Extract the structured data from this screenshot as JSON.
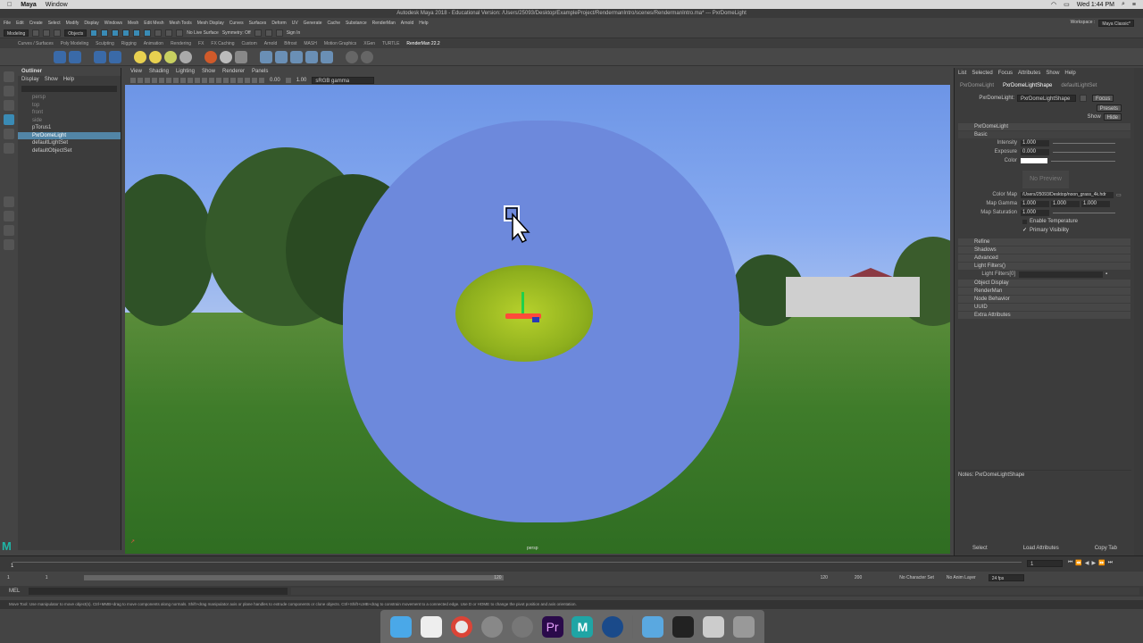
{
  "mac_menu": {
    "app": "Maya",
    "window": "Window",
    "clock": "Wed 1:44 PM"
  },
  "window_title": "Autodesk Maya 2018 - Educational Version: /Users/25093/Desktop/ExampleProject/RendermanIntro/scenes/RendermanIntro.ma*  ---  PxrDomeLight",
  "main_menu": [
    "File",
    "Edit",
    "Create",
    "Select",
    "Modify",
    "Display",
    "Windows",
    "Mesh",
    "Edit Mesh",
    "Mesh Tools",
    "Mesh Display",
    "Curves",
    "Surfaces",
    "Deform",
    "UV",
    "Generate",
    "Cache",
    "Substance",
    "RenderMan",
    "Arnold",
    "Help"
  ],
  "workspace": {
    "label": "Workspace :",
    "value": "Maya Classic*"
  },
  "status": {
    "mode": "Modeling",
    "objects": "Objects",
    "live_surface": "No Live Surface",
    "symmetry": "Symmetry: Off",
    "sign_in": "Sign In"
  },
  "shelf_tabs": [
    "Curves / Surfaces",
    "Poly Modeling",
    "Sculpting",
    "Rigging",
    "Animation",
    "Rendering",
    "FX",
    "FX Caching",
    "Custom",
    "Arnold",
    "Bifrost",
    "MASH",
    "Motion Graphics",
    "XGen",
    "TURTLE",
    "RenderMan 22.2"
  ],
  "shelf_active": "RenderMan 22.2",
  "outliner": {
    "title": "Outliner",
    "menu": [
      "Display",
      "Show",
      "Help"
    ],
    "items": [
      {
        "label": "persp",
        "state": "dim"
      },
      {
        "label": "top",
        "state": "dim"
      },
      {
        "label": "front",
        "state": "dim"
      },
      {
        "label": "side",
        "state": "dim"
      },
      {
        "label": "pTorus1",
        "state": "normal"
      },
      {
        "label": "PxrDomeLight",
        "state": "sel"
      },
      {
        "label": "defaultLightSet",
        "state": "normal"
      },
      {
        "label": "defaultObjectSet",
        "state": "normal"
      }
    ]
  },
  "viewport": {
    "menu": [
      "View",
      "Shading",
      "Lighting",
      "Show",
      "Renderer",
      "Panels"
    ],
    "exposure": "0.00",
    "gamma": "1.00",
    "color_space": "sRGB gamma",
    "camera_label": "persp"
  },
  "attribute_editor": {
    "menu": [
      "List",
      "Selected",
      "Focus",
      "Attributes",
      "Show",
      "Help"
    ],
    "tabs": [
      "PxrDomeLight",
      "PxrDomeLightShape",
      "defaultLightSet"
    ],
    "active_tab": "PxrDomeLightShape",
    "node_label": "PxrDomeLight:",
    "node_value": "PxrDomeLightShape",
    "buttons": {
      "focus": "Focus",
      "presets": "Presets",
      "show": "Show",
      "hide": "Hide"
    },
    "section_main": "PxrDomeLight",
    "section_basic": "Basic",
    "intensity": {
      "label": "Intensity",
      "value": "1.000"
    },
    "exposure": {
      "label": "Exposure",
      "value": "0.000"
    },
    "color": {
      "label": "Color"
    },
    "no_preview": "No Preview",
    "color_map": {
      "label": "Color Map",
      "value": "/Users/25093/Desktop/noon_grass_4k.hdr"
    },
    "map_gamma": {
      "label": "Map Gamma",
      "values": [
        "1.000",
        "1.000",
        "1.000"
      ]
    },
    "map_saturation": {
      "label": "Map Saturation",
      "value": "1.000"
    },
    "enable_temperature": "Enable Temperature",
    "primary_visibility": "Primary Visibility",
    "sections": [
      "Refine",
      "Shadows",
      "Advanced",
      "Light Filters()"
    ],
    "light_filters_label": "Light Filters[0]",
    "sections2": [
      "Object Display",
      "RenderMan",
      "Node Behavior",
      "UUID",
      "Extra Attributes"
    ],
    "notes": "Notes:  PxrDomeLightShape",
    "bottom_buttons": [
      "Select",
      "Load Attributes",
      "Copy Tab"
    ]
  },
  "timeline": {
    "start": "1",
    "current": "1",
    "range_start": "1",
    "range_end": "120",
    "end": "120",
    "anim_end": "200",
    "frame_field": "1",
    "character_set": "No Character Set",
    "anim_layer": "No Anim Layer",
    "fps": "24 fps"
  },
  "cmd": {
    "lang": "MEL"
  },
  "help_line": "Move Tool: Use manipulator to move object(s). Ctrl+MMB+drag to move components along normals. Shift+drag manipulator axis or plane handles to extrude components or clone objects. Ctrl+Shift+LMB+drag to constrain movement to a connected edge. Use D or HOME to change the pivot position and axis orientation.",
  "dock_icons": [
    "finder-icon",
    "notes-icon",
    "chrome-icon",
    "launchpad-icon",
    "system-prefs-icon",
    "premiere-icon",
    "maya-icon",
    "quicktime-icon",
    "folder-icon",
    "terminal-icon",
    "preview-icon",
    "trash-icon"
  ],
  "colors": {
    "selection": "#5285a6",
    "dome": "#6d89dc",
    "premiere": "#2a0a4a",
    "maya": "#1fa5a5"
  }
}
